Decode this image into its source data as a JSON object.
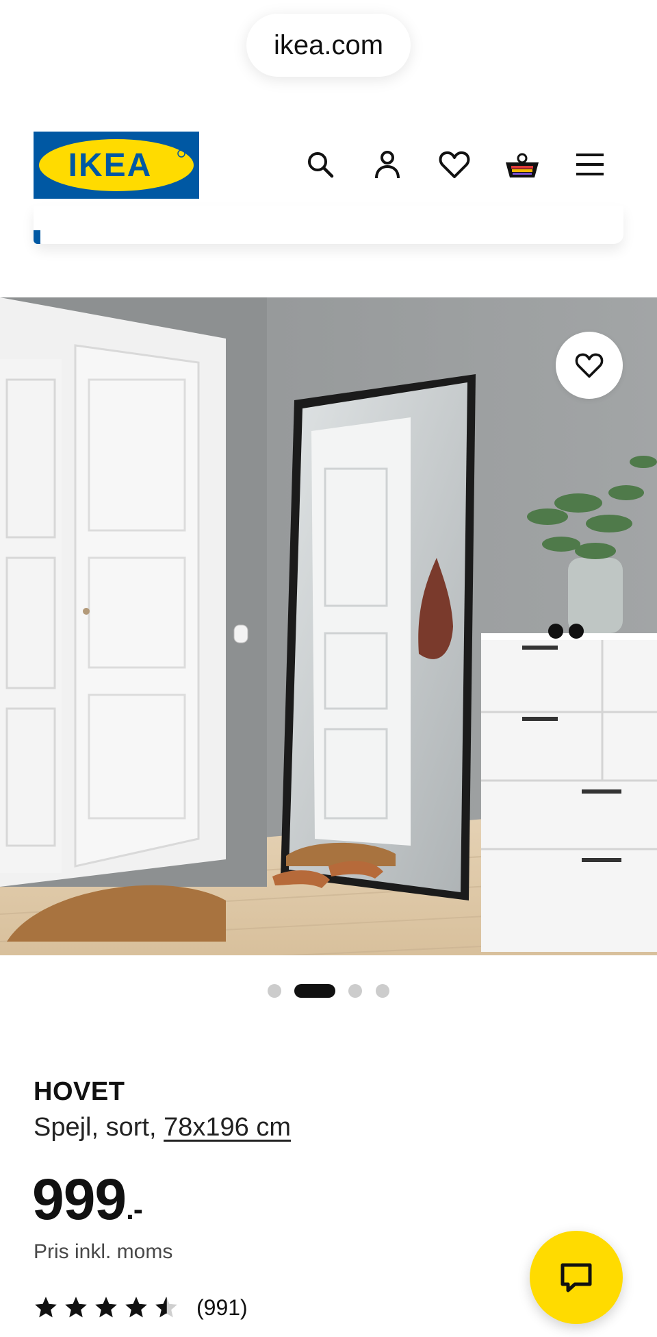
{
  "browser": {
    "url": "ikea.com"
  },
  "header": {
    "logo_text": "IKEA",
    "icons": [
      "search-icon",
      "account-icon",
      "favorites-icon",
      "cart-icon",
      "menu-icon"
    ],
    "brand_blue": "#0058a3",
    "brand_yellow": "#ffdb00"
  },
  "gallery": {
    "image_count": 4,
    "active_index": 1,
    "favorite_icon": "heart-icon"
  },
  "product": {
    "name": "HOVET",
    "description": "Spejl, sort,",
    "size_link": "78x196 cm",
    "price_main": "999",
    "price_suffix": ".-",
    "price_note": "Pris inkl. moms",
    "rating_value": 4.5,
    "rating_max": 5,
    "review_count": "(991)"
  },
  "chat": {
    "icon": "chat-icon",
    "color": "#ffdb00"
  }
}
